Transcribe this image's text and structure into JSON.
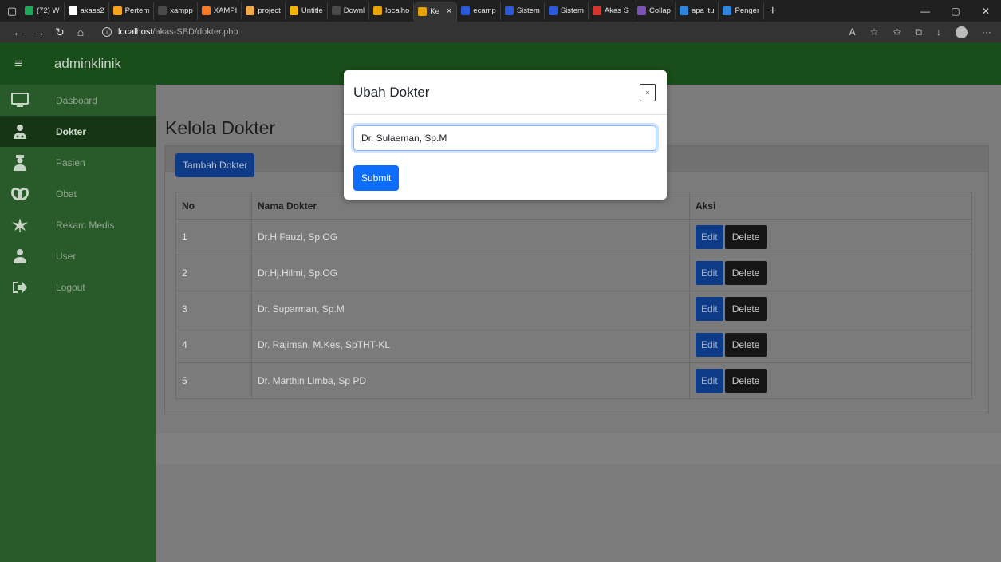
{
  "browser": {
    "tabs": [
      {
        "label": "(72) W",
        "color": "#1fa85a"
      },
      {
        "label": "akass2",
        "color": "#ffffff"
      },
      {
        "label": "Pertem",
        "color": "#f7a21b"
      },
      {
        "label": "xampp",
        "color": "#4a4a4a"
      },
      {
        "label": "XAMPI",
        "color": "#fb7a24"
      },
      {
        "label": "project",
        "color": "#f0a94a"
      },
      {
        "label": "Untitle",
        "color": "#f3b400"
      },
      {
        "label": "Downl",
        "color": "#4a4a4a"
      },
      {
        "label": "localho",
        "color": "#e8a400"
      },
      {
        "label": "Ke",
        "color": "#e8a400",
        "active": true
      },
      {
        "label": "ecamp",
        "color": "#2b5ad9"
      },
      {
        "label": "Sistem",
        "color": "#2b5ad9"
      },
      {
        "label": "Sistem",
        "color": "#2b5ad9"
      },
      {
        "label": "Akas S",
        "color": "#d9342b"
      },
      {
        "label": "Collap",
        "color": "#7952b3"
      },
      {
        "label": "apa itu",
        "color": "#2e86de"
      },
      {
        "label": "Penger",
        "color": "#2e86de"
      }
    ],
    "url_host": "localhost",
    "url_path": "/akas-SBD/dokter.php"
  },
  "app": {
    "brand": "adminklinik",
    "menu_icon": "hamburger-icon"
  },
  "sidebar": {
    "items": [
      {
        "label": "Dasboard",
        "icon": "monitor-icon"
      },
      {
        "label": "Dokter",
        "icon": "doctor-icon",
        "active": true
      },
      {
        "label": "Pasien",
        "icon": "patient-icon"
      },
      {
        "label": "Obat",
        "icon": "pills-icon"
      },
      {
        "label": "Rekam Medis",
        "icon": "leaf-icon"
      },
      {
        "label": "User",
        "icon": "user-icon"
      },
      {
        "label": "Logout",
        "icon": "logout-icon"
      }
    ]
  },
  "main": {
    "title": "Kelola Dokter",
    "add_button": "Tambah Dokter",
    "table": {
      "headers": [
        "No",
        "Nama Dokter",
        "Aksi"
      ],
      "rows": [
        {
          "no": "1",
          "nama": "Dr.H Fauzi, Sp.OG"
        },
        {
          "no": "2",
          "nama": "Dr.Hj.Hilmi, Sp.OG"
        },
        {
          "no": "3",
          "nama": "Dr. Suparman, Sp.M"
        },
        {
          "no": "4",
          "nama": "Dr. Rajiman, M.Kes, SpTHT-KL"
        },
        {
          "no": "5",
          "nama": "Dr. Marthin Limba, Sp PD"
        }
      ],
      "edit_label": "Edit",
      "delete_label": "Delete"
    }
  },
  "modal": {
    "title": "Ubah Dokter",
    "close_label": "×",
    "input_value": "Dr. Sulaeman, Sp.M",
    "submit_label": "Submit"
  }
}
